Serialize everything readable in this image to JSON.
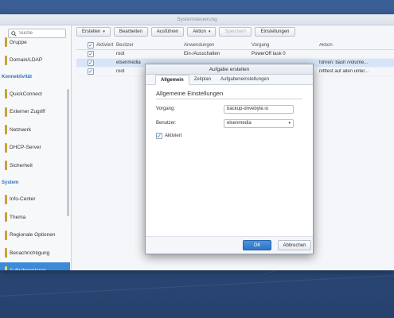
{
  "window": {
    "title": "Systemsteuerung"
  },
  "search": {
    "placeholder": "Suche"
  },
  "sidebar": {
    "items": [
      {
        "label": "Gruppe",
        "type": "item"
      },
      {
        "label": "Domain/LDAP",
        "type": "item"
      },
      {
        "label": "Konnektivität",
        "type": "section"
      },
      {
        "label": "QuickConnect",
        "type": "item"
      },
      {
        "label": "Externer Zugriff",
        "type": "item"
      },
      {
        "label": "Netzwerk",
        "type": "item"
      },
      {
        "label": "DHCP-Server",
        "type": "item"
      },
      {
        "label": "Sicherheit",
        "type": "item"
      },
      {
        "label": "System",
        "type": "section"
      },
      {
        "label": "Info-Center",
        "type": "item"
      },
      {
        "label": "Thema",
        "type": "item"
      },
      {
        "label": "Regionale Optionen",
        "type": "item"
      },
      {
        "label": "Benachrichtigung",
        "type": "item"
      },
      {
        "label": "Aufgabenplaner",
        "type": "item",
        "active": true
      }
    ]
  },
  "toolbar": {
    "create": "Erstellen",
    "edit": "Bearbeiten",
    "run": "Ausführen",
    "action": "Aktion",
    "save": "Speichern",
    "settings": "Einstellungen"
  },
  "table": {
    "headers": [
      "Aktiviert",
      "Besitzer",
      "Anwendungen",
      "Vorgang",
      "Aktion"
    ],
    "rows": [
      {
        "checked": true,
        "owner": "root",
        "app": "Ein-/Ausschalten",
        "process": "PowerOff task 0",
        "action": ""
      },
      {
        "checked": true,
        "owner": "elsenmedia",
        "app": "",
        "process": "",
        "action": "führen: bash /volume...",
        "selected": true
      },
      {
        "checked": true,
        "owner": "root",
        "app": "",
        "process": "",
        "action": "nifttest auf allen unter..."
      }
    ]
  },
  "dialog": {
    "title": "Aufgabe erstellen",
    "tabs": [
      "Allgemein",
      "Zeitplan",
      "Aufgabeneinstellungen"
    ],
    "section_title": "Allgemeine Einstellungen",
    "task_label": "Vorgang:",
    "task_value": "backup-drivebyte.io",
    "user_label": "Benutzer:",
    "user_value": "elsenmedia",
    "enabled_label": "Aktiviert",
    "ok": "OK",
    "cancel": "Abbrechen"
  },
  "colors": {
    "accent": "#3c8ad8",
    "desktop": "#2d4d80"
  }
}
